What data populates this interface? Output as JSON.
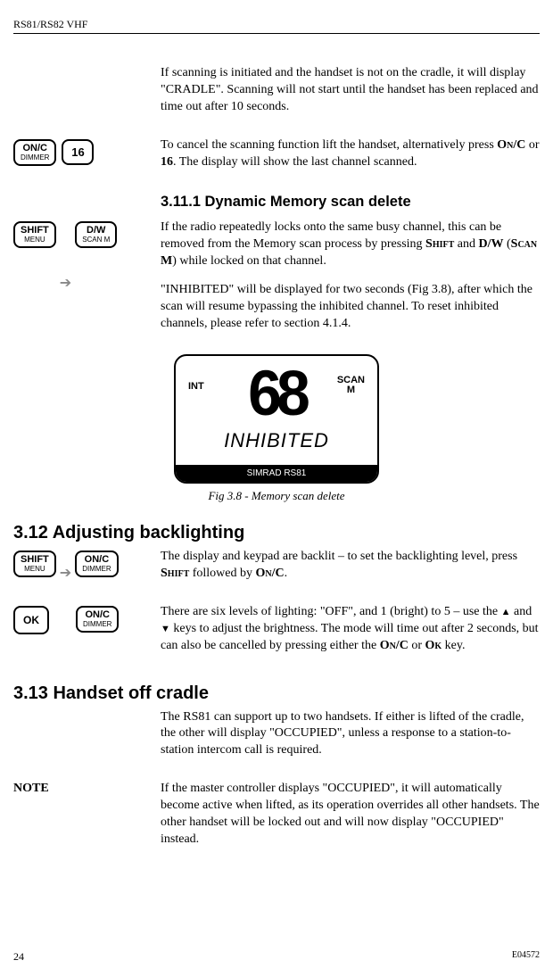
{
  "header": "RS81/RS82 VHF",
  "p1": "If scanning is initiated and the handset is not on the cradle, it will display \"CRADLE\". Scanning will not start until the handset has been replaced and time out after 10 seconds.",
  "p2a": "To cancel the scanning function lift the handset, alternatively press ",
  "p2b": "On/C",
  "p2c": " or ",
  "p2d": "16",
  "p2e": ". The display will show the last channel scanned.",
  "h311": "3.11.1  Dynamic Memory scan delete",
  "p3a": "If the radio repeatedly locks onto the same busy channel, this can be removed from the Memory scan process by pressing ",
  "p3b": "Shift",
  "p3c": " and ",
  "p3d": "D/W",
  "p3e": " (",
  "p3f": "Scan M",
  "p3g": ") while locked on that channel.",
  "p4": "\"INHIBITED\" will be displayed for two seconds (Fig 3.8), after which the scan will resume bypassing the inhibited channel. To reset inhibited channels, please refer to section 4.1.4.",
  "lcd": {
    "int": "INT",
    "digits": "68",
    "scan": "SCAN",
    "m": "M",
    "mid": "INHIBITED",
    "bar": "SIMRAD RS81"
  },
  "caption": "Fig 3.8 - Memory scan delete",
  "h312": "3.12  Adjusting backlighting",
  "p5a": "The display and keypad are backlit – to set the backlighting level, press ",
  "p5b": "Shift",
  "p5c": " followed by ",
  "p5d": "On/C",
  "p5e": ".",
  "p6a": "There are six levels of lighting: \"OFF\", and 1 (bright) to 5 – use the ",
  "p6b": " and ",
  "p6c": " keys to adjust the brightness. The mode will time out after 2 seconds, but can also be cancelled by pressing either the ",
  "p6d": "On/C",
  "p6e": " or ",
  "p6f": "Ok",
  "p6g": " key.",
  "h313": "3.13  Handset off cradle",
  "p7": "The RS81 can support up to two handsets. If either is lifted of the cradle, the other will display \"OCCUPIED\", unless a response to a station-to-station intercom call is required.",
  "noteLabel": "NOTE",
  "p8": "If the master controller displays \"OCCUPIED\", it will automatically become active when lifted, as its operation overrides all other handsets. The other handset will be locked out and will now display \"OCCUPIED\" instead.",
  "pageNum": "24",
  "docId": "E04572",
  "keys": {
    "onc": {
      "top": "ON/C",
      "bot": "DIMMER"
    },
    "k16": {
      "top": "16",
      "bot": ""
    },
    "shift": {
      "top": "SHIFT",
      "bot": "MENU"
    },
    "dw": {
      "top": "D/W",
      "bot": "SCAN M"
    },
    "ok": {
      "top": "OK",
      "bot": ""
    }
  }
}
